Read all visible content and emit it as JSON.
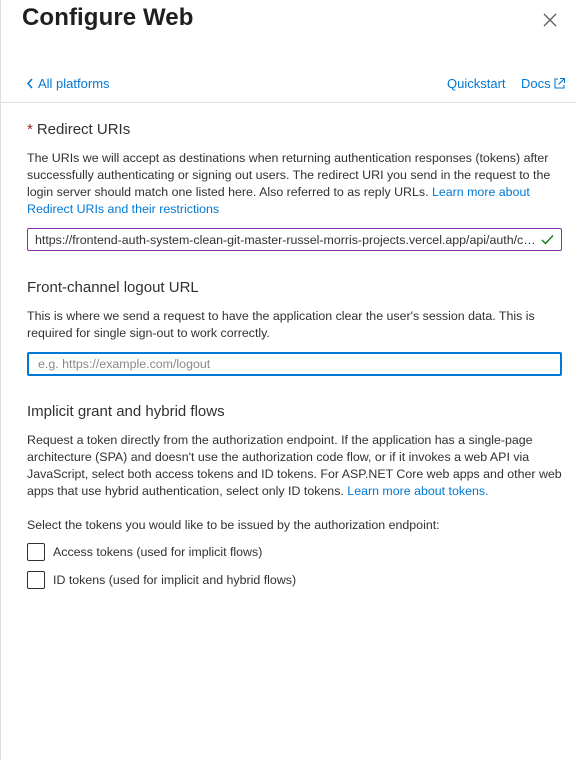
{
  "header": {
    "title": "Configure Web",
    "close_label": "✕"
  },
  "nav": {
    "back_label": "All platforms",
    "quickstart_label": "Quickstart",
    "docs_label": "Docs"
  },
  "redirect": {
    "required_mark": "*",
    "title": "Redirect URIs",
    "description": "The URIs we will accept as destinations when returning authentication responses (tokens) after successfully authenticating or signing out users. The redirect URI you send in the request to the login server should match one listed here. Also referred to as reply URLs.",
    "learn_more": "Learn more about Redirect URIs and their restrictions",
    "uri_value": "https://frontend-auth-system-clean-git-master-russel-morris-projects.vercel.app/api/auth/callback"
  },
  "logout": {
    "title": "Front-channel logout URL",
    "description": "This is where we send a request to have the application clear the user's session data. This is required for single sign-out to work correctly.",
    "placeholder": "e.g. https://example.com/logout",
    "value": ""
  },
  "implicit": {
    "title": "Implicit grant and hybrid flows",
    "description": "Request a token directly from the authorization endpoint. If the application has a single-page architecture (SPA) and doesn't use the authorization code flow, or if it invokes a web API via JavaScript, select both access tokens and ID tokens. For ASP.NET Core web apps and other web apps that use hybrid authentication, select only ID tokens.",
    "learn_more": "Learn more about tokens.",
    "select_prompt": "Select the tokens you would like to be issued by the authorization endpoint:",
    "options": [
      {
        "label": "Access tokens (used for implicit flows)",
        "checked": false
      },
      {
        "label": "ID tokens (used for implicit and hybrid flows)",
        "checked": false
      }
    ]
  },
  "colors": {
    "accent": "#0078d4",
    "required": "#a4262c",
    "uri_border": "#8a2da5",
    "valid_check": "#107c10"
  },
  "icons": {
    "close": "close-icon",
    "back": "chevron-left-icon",
    "docs": "external-link-icon",
    "valid": "checkmark-icon"
  }
}
